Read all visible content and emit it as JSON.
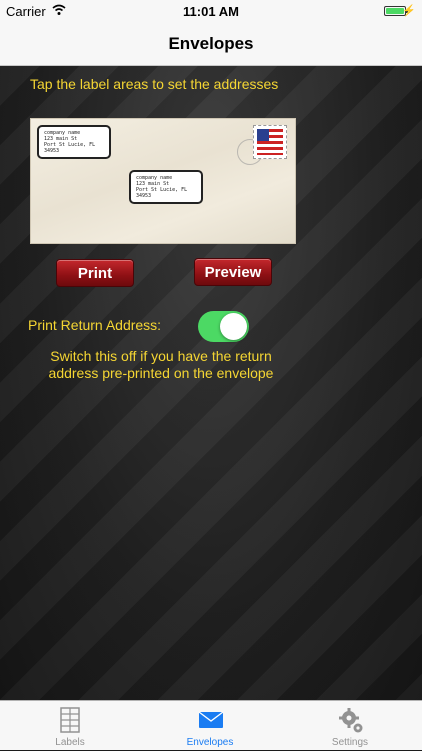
{
  "status_bar": {
    "carrier": "Carrier",
    "time": "11:01 AM",
    "battery_level": 1.0
  },
  "nav": {
    "title": "Envelopes"
  },
  "instruction": "Tap the label areas to set the addresses",
  "envelope": {
    "return_address": [
      "company name",
      "123 main St",
      "Port St Lucie, FL 34953"
    ],
    "destination_address": [
      "company name",
      "123 main St",
      "Port St Lucie, FL 34953"
    ],
    "stamp_icon": "us-flag-stamp-icon"
  },
  "buttons": {
    "print": "Print",
    "preview": "Preview"
  },
  "return_toggle": {
    "label": "Print Return Address:",
    "on": true,
    "hint": "Switch this off if you have the return address pre-printed on the envelope"
  },
  "tabs": [
    {
      "label": "Labels",
      "icon": "grid-icon",
      "active": false
    },
    {
      "label": "Envelopes",
      "icon": "envelope-icon",
      "active": true
    },
    {
      "label": "Settings",
      "icon": "gears-icon",
      "active": false
    }
  ],
  "colors": {
    "accent_text": "#f5d633",
    "button_red": "#8e1014",
    "toggle_on": "#4cd964",
    "tab_active": "#1a7cf2",
    "tab_inactive": "#929292"
  }
}
